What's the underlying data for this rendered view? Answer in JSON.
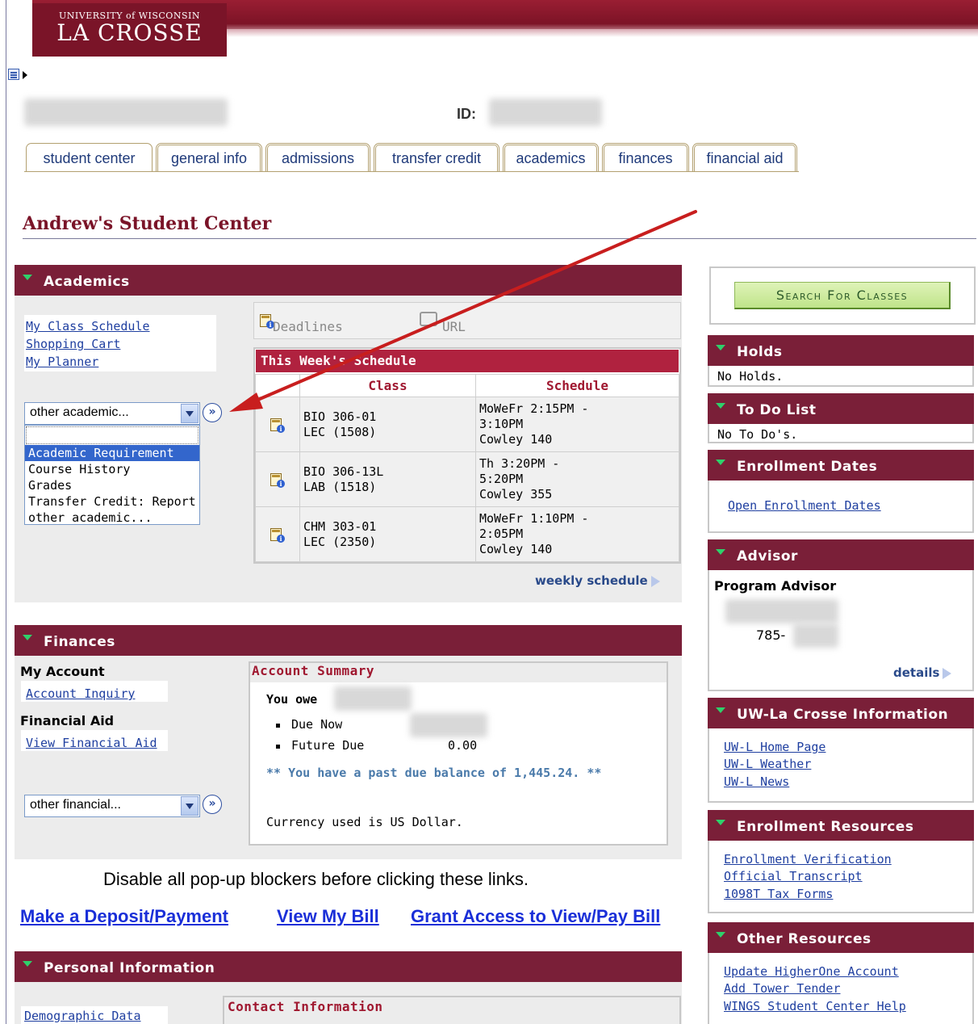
{
  "logo": {
    "line1": "UNIVERSITY of WISCONSIN",
    "line2": "LA CROSSE"
  },
  "id_label": "ID:",
  "tabs": [
    {
      "label": "student center",
      "active": true
    },
    {
      "label": "general info"
    },
    {
      "label": "admissions"
    },
    {
      "label": "transfer credit"
    },
    {
      "label": "academics"
    },
    {
      "label": "finances"
    },
    {
      "label": "financial aid"
    }
  ],
  "page_title": "Andrew's Student Center",
  "academics": {
    "header": "Academics",
    "links": [
      "My Class Schedule",
      "Shopping Cart",
      "My Planner"
    ],
    "dropdown_value": "other academic...",
    "dropdown_options": [
      "Academic Requirement",
      "Course History",
      "Grades",
      "Transfer Credit: Report",
      "other academic..."
    ],
    "toolbar": {
      "deadlines": "Deadlines",
      "url": "URL"
    },
    "schedule": {
      "title": "This Week's Schedule",
      "col_class": "Class",
      "col_schedule": "Schedule",
      "rows": [
        {
          "class1": "BIO 306-01",
          "class2": "LEC (1508)",
          "s1": "MoWeFr 2:15PM -",
          "s2": "3:10PM",
          "s3": "Cowley 140"
        },
        {
          "class1": "BIO 306-13L",
          "class2": "LAB (1518)",
          "s1": "Th 3:20PM -",
          "s2": "5:20PM",
          "s3": "Cowley 355"
        },
        {
          "class1": "CHM 303-01",
          "class2": "LEC (2350)",
          "s1": "MoWeFr 1:10PM -",
          "s2": "2:05PM",
          "s3": "Cowley 140"
        }
      ],
      "weekly_link": "weekly schedule"
    }
  },
  "finances": {
    "header": "Finances",
    "my_account": "My Account",
    "account_inquiry": "Account Inquiry",
    "financial_aid": "Financial Aid",
    "view_financial_aid": "View Financial Aid",
    "dropdown_value": "other financial...",
    "summary": {
      "title": "Account Summary",
      "you_owe": "You owe",
      "due_now": "Due Now",
      "future_due": "Future Due",
      "future_due_value": "0.00",
      "past_due": "** You have a past due balance of 1,445.24. **",
      "currency": "Currency used is US Dollar."
    }
  },
  "popup_note": "Disable all pop-up blockers before clicking these links.",
  "payment_links": [
    "Make a Deposit/Payment",
    "View My Bill",
    "Grant Access to View/Pay Bill"
  ],
  "personal": {
    "header": "Personal Information",
    "demographic": "Demographic Data",
    "contact_title": "Contact Information"
  },
  "sidebar": {
    "search_button": "Search For Classes",
    "holds": {
      "header": "Holds",
      "text": "No Holds."
    },
    "todo": {
      "header": "To Do List",
      "text": "No To Do's."
    },
    "enrollment_dates": {
      "header": "Enrollment Dates",
      "link": "Open Enrollment Dates"
    },
    "advisor": {
      "header": "Advisor",
      "title": "Program Advisor",
      "phone_prefix": "785-",
      "details": "details"
    },
    "uwl_info": {
      "header": "UW-La Crosse Information",
      "links": [
        "UW-L Home Page",
        "UW-L Weather",
        "UW-L News"
      ]
    },
    "enrollment_resources": {
      "header": "Enrollment Resources",
      "links": [
        "Enrollment Verification",
        "Official Transcript",
        "1098T Tax Forms"
      ]
    },
    "other_resources": {
      "header": "Other Resources",
      "links": [
        "Update HigherOne Account",
        "Add Tower Tender",
        "WINGS Student Center Help"
      ]
    }
  },
  "colors": {
    "maroon": "#7a1f38",
    "schedule_header": "#b0223f",
    "link": "#1f3fa0",
    "annotation_arrow": "#c81e1e"
  }
}
